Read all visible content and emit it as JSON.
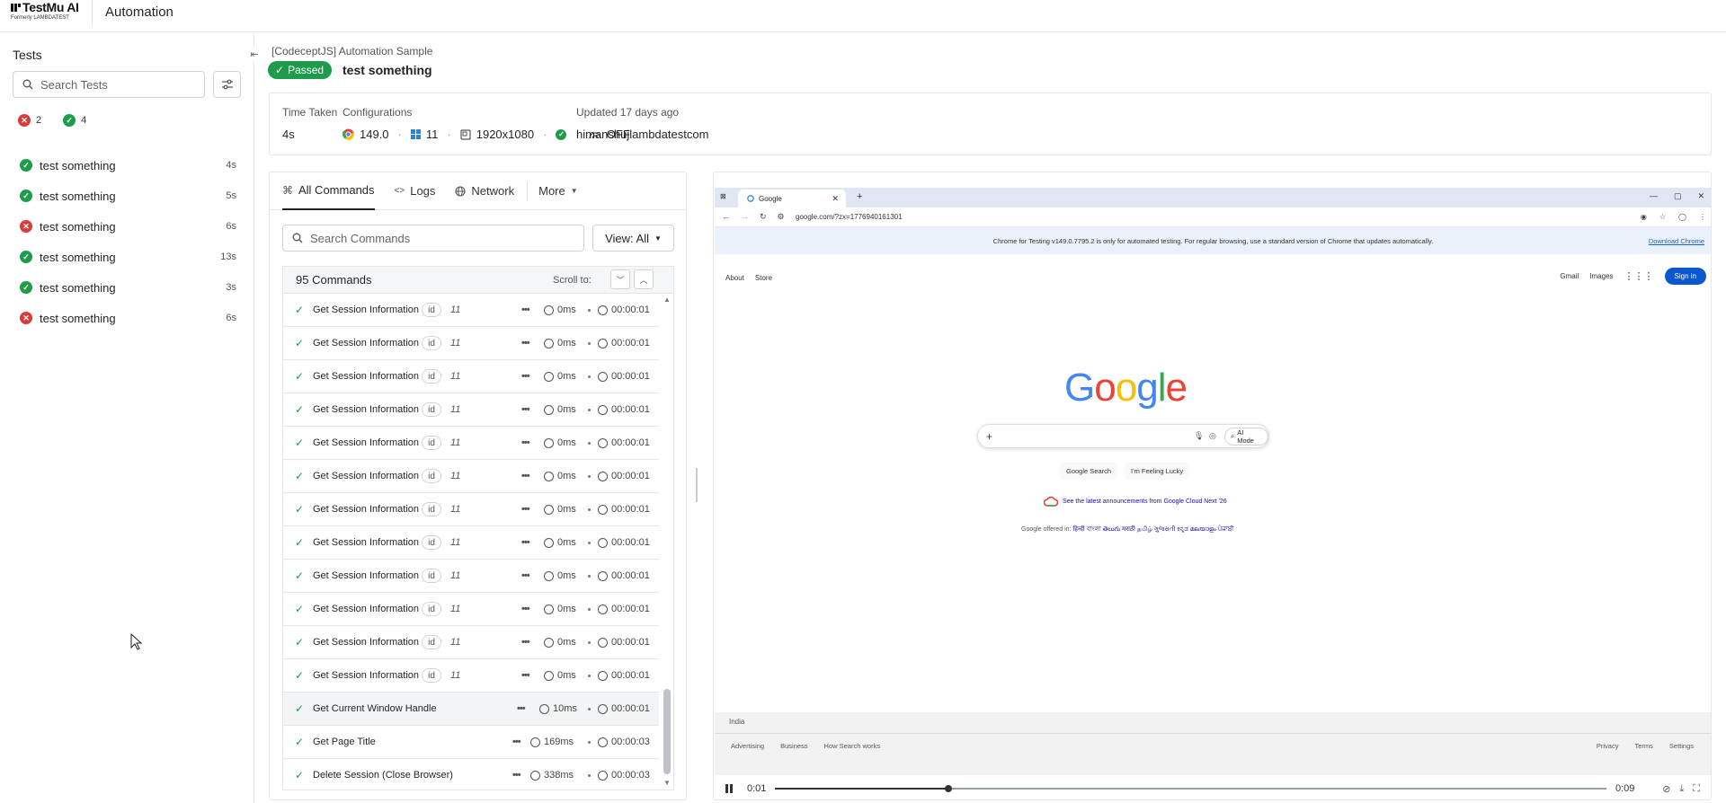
{
  "header": {
    "logo_name": "TestMu AI",
    "logo_sub": "Formerly LAMBDATEST",
    "title": "Automation"
  },
  "sidebar": {
    "heading": "Tests",
    "search_placeholder": "Search Tests",
    "failed_count": "2",
    "passed_count": "4",
    "tests": [
      {
        "label": "test something",
        "duration": "4s",
        "status": "passed"
      },
      {
        "label": "test something",
        "duration": "5s",
        "status": "passed"
      },
      {
        "label": "test something",
        "duration": "6s",
        "status": "failed"
      },
      {
        "label": "test something",
        "duration": "13s",
        "status": "passed"
      },
      {
        "label": "test something",
        "duration": "3s",
        "status": "passed"
      },
      {
        "label": "test something",
        "duration": "6s",
        "status": "failed"
      }
    ]
  },
  "main": {
    "breadcrumb": "[CodeceptJS] Automation Sample",
    "status_badge": "Passed",
    "test_title": "test something",
    "info": {
      "time_taken_label": "Time Taken",
      "time_taken_value": "4s",
      "config_label": "Configurations",
      "browser_version": "149.0",
      "os_version": "11",
      "resolution": "1920x1080",
      "tunnel": "OFF",
      "updated_label": "Updated 17 days ago",
      "username": "himanshujlambdatestcom"
    }
  },
  "commands": {
    "tabs": [
      "All Commands",
      "Logs",
      "Network",
      "More"
    ],
    "search_placeholder": "Search Commands",
    "view_label": "View: All",
    "count_label": "95 Commands",
    "scroll_to_label": "Scroll to:",
    "rows": [
      {
        "name": "Get Session Information",
        "id": "id",
        "idval": "11",
        "ms": "0ms",
        "time": "00:00:01"
      },
      {
        "name": "Get Session Information",
        "id": "id",
        "idval": "11",
        "ms": "0ms",
        "time": "00:00:01"
      },
      {
        "name": "Get Session Information",
        "id": "id",
        "idval": "11",
        "ms": "0ms",
        "time": "00:00:01"
      },
      {
        "name": "Get Session Information",
        "id": "id",
        "idval": "11",
        "ms": "0ms",
        "time": "00:00:01"
      },
      {
        "name": "Get Session Information",
        "id": "id",
        "idval": "11",
        "ms": "0ms",
        "time": "00:00:01"
      },
      {
        "name": "Get Session Information",
        "id": "id",
        "idval": "11",
        "ms": "0ms",
        "time": "00:00:01"
      },
      {
        "name": "Get Session Information",
        "id": "id",
        "idval": "11",
        "ms": "0ms",
        "time": "00:00:01"
      },
      {
        "name": "Get Session Information",
        "id": "id",
        "idval": "11",
        "ms": "0ms",
        "time": "00:00:01"
      },
      {
        "name": "Get Session Information",
        "id": "id",
        "idval": "11",
        "ms": "0ms",
        "time": "00:00:01"
      },
      {
        "name": "Get Session Information",
        "id": "id",
        "idval": "11",
        "ms": "0ms",
        "time": "00:00:01"
      },
      {
        "name": "Get Session Information",
        "id": "id",
        "idval": "11",
        "ms": "0ms",
        "time": "00:00:01"
      },
      {
        "name": "Get Session Information",
        "id": "id",
        "idval": "11",
        "ms": "0ms",
        "time": "00:00:01"
      },
      {
        "name": "Get Current Window Handle",
        "id": "",
        "idval": "",
        "ms": "10ms",
        "time": "00:00:01"
      },
      {
        "name": "Get Page Title",
        "id": "",
        "idval": "",
        "ms": "169ms",
        "time": "00:00:03"
      },
      {
        "name": "Delete Session (Close Browser)",
        "id": "",
        "idval": "",
        "ms": "338ms",
        "time": "00:00:03"
      }
    ]
  },
  "video": {
    "browser_tab": "Google",
    "url": "google.com/?zx=1776940161301",
    "banner": "Chrome for Testing v149.0.7795.2 is only for automated testing. For regular browsing, use a standard version of Chrome that updates automatically.",
    "banner_link": "Download Chrome",
    "nav_about": "About",
    "nav_store": "Store",
    "nav_gmail": "Gmail",
    "nav_images": "Images",
    "signin": "Sign in",
    "logo": "Google",
    "ai_mode": "AI Mode",
    "btn_search": "Google Search",
    "btn_lucky": "I'm Feeling Lucky",
    "cloud_text": "See the latest announcements from Google Cloud Next '26",
    "offered_prefix": "Google offered in:",
    "offered_langs": "हिन्दी বাংলা తెలుగు मराठी தமிழ் ગુજરાતી ಕನ್ನಡ മലയാളം ਪੰਜਾਬੀ",
    "country": "India",
    "footer_left": [
      "Advertising",
      "Business",
      "How Search works"
    ],
    "footer_right": [
      "Privacy",
      "Terms",
      "Settings"
    ],
    "current_time": "0:01",
    "total_time": "0:09",
    "progress": 0.209
  }
}
